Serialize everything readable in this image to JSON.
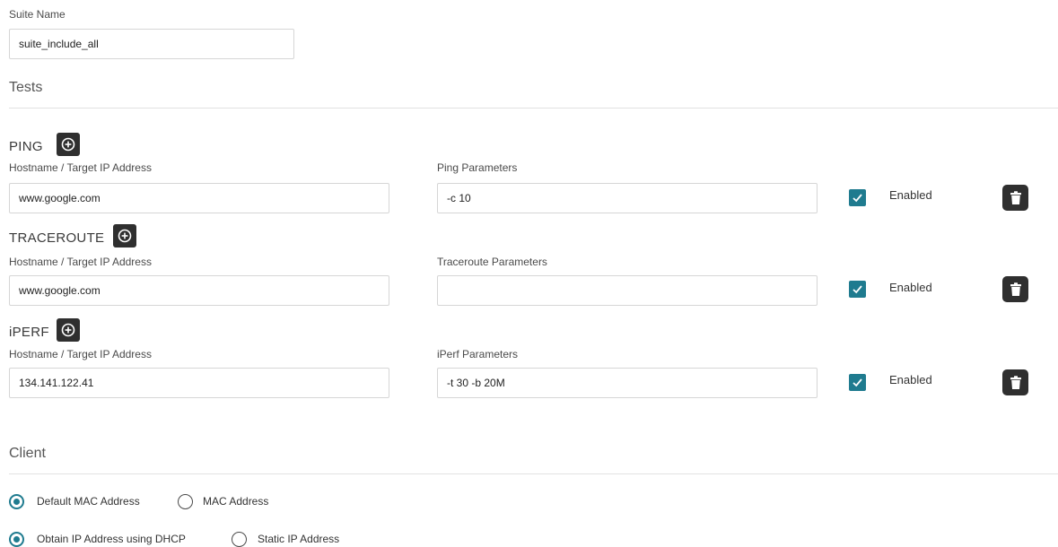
{
  "suite": {
    "label": "Suite Name",
    "value": "suite_include_all"
  },
  "tests": {
    "title": "Tests",
    "ping": {
      "name": "PING",
      "host_label": "Hostname / Target IP Address",
      "host_value": "www.google.com",
      "params_label": "Ping Parameters",
      "params_value": "-c 10",
      "enabled_label": "Enabled",
      "enabled": true
    },
    "traceroute": {
      "name": "TRACEROUTE",
      "host_label": "Hostname / Target IP Address",
      "host_value": "www.google.com",
      "params_label": "Traceroute Parameters",
      "params_value": "",
      "enabled_label": "Enabled",
      "enabled": true
    },
    "iperf": {
      "name": "iPERF",
      "host_label": "Hostname / Target IP Address",
      "host_value": "134.141.122.41",
      "params_label": "iPerf Parameters",
      "params_value": "-t 30 -b 20M",
      "enabled_label": "Enabled",
      "enabled": true
    }
  },
  "client": {
    "title": "Client",
    "mac_options": [
      {
        "label": "Default MAC Address",
        "selected": true
      },
      {
        "label": "MAC Address",
        "selected": false
      }
    ],
    "ip_options": [
      {
        "label": "Obtain IP Address using DHCP",
        "selected": true
      },
      {
        "label": "Static IP Address",
        "selected": false
      }
    ]
  },
  "icons": {
    "add": "plus-circle-icon",
    "delete": "trash-icon",
    "check": "check-icon"
  },
  "colors": {
    "accent": "#1f7b8f",
    "dark_button": "#2f2f2f",
    "divider": "#e2e2e2"
  }
}
